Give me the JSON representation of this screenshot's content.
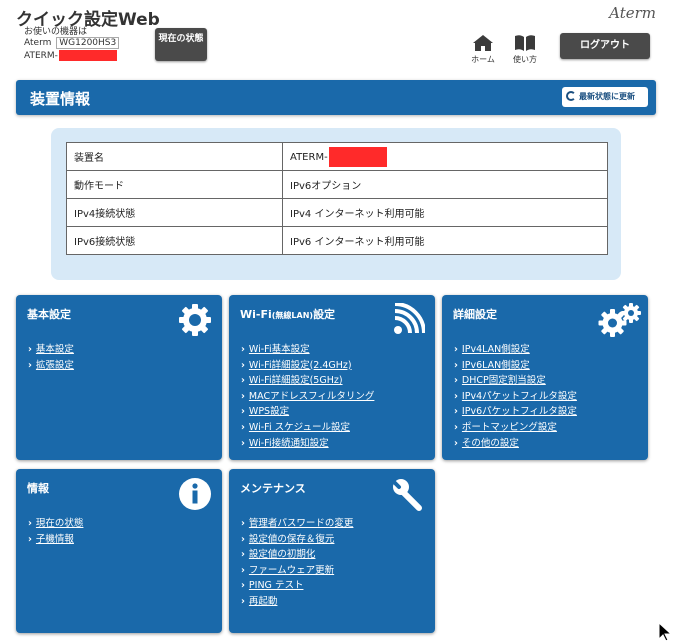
{
  "header": {
    "title": "クイック設定Web",
    "device_label": "お使いの機器は",
    "device_model_prefix": "Aterm",
    "device_model": "WG1200HS3",
    "device_name_prefix": "ATERM-",
    "status_button": "現在の状態",
    "brand": "Aterm",
    "home_label": "ホーム",
    "manual_label": "使い方",
    "logout_label": "ログアウト"
  },
  "device_info": {
    "title": "装置情報",
    "refresh_label": "最新状態に更新",
    "rows": [
      {
        "key": "装置名",
        "value": "ATERM-"
      },
      {
        "key": "動作モード",
        "value": "IPv6オプション"
      },
      {
        "key": "IPv4接続状態",
        "value": "IPv4 インターネット利用可能"
      },
      {
        "key": "IPv6接続状態",
        "value": "IPv6 インターネット利用可能"
      }
    ]
  },
  "cards": {
    "basic": {
      "title": "基本設定",
      "icon": "gear-icon",
      "links": [
        "基本設定",
        "拡張設定"
      ]
    },
    "wifi": {
      "title_main": "Wi-Fi",
      "title_small": "(無線LAN)",
      "title_end": "設定",
      "icon": "wifi-icon",
      "links": [
        "Wi-Fi基本設定",
        "Wi-Fi詳細設定(2.4GHz)",
        "Wi-Fi詳細設定(5GHz)",
        "MACアドレスフィルタリング",
        "WPS設定",
        "Wi-Fi スケジュール設定",
        "Wi-Fi接続通知設定"
      ]
    },
    "advanced": {
      "title": "詳細設定",
      "icon": "gears-icon",
      "links": [
        "IPv4LAN側設定",
        "IPv6LAN側設定",
        "DHCP固定割当設定",
        "IPv4パケットフィルタ設定",
        "IPv6パケットフィルタ設定",
        "ポートマッピング設定",
        "その他の設定"
      ]
    },
    "info": {
      "title": "情報",
      "icon": "info-icon",
      "links": [
        "現在の状態",
        "子機情報"
      ]
    },
    "maintenance": {
      "title": "メンテナンス",
      "icon": "wrench-icon",
      "links": [
        "管理者パスワードの変更",
        "設定値の保存＆復元",
        "設定値の初期化",
        "ファームウェア更新",
        "PING テスト",
        "再起動"
      ]
    }
  },
  "colors": {
    "primary": "#1a69aa",
    "panel": "#d7e9f7",
    "dark_button": "#4a4a4a",
    "redaction": "#ff2a2a"
  }
}
